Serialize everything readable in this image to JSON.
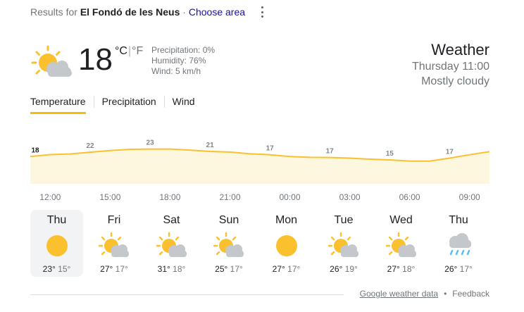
{
  "header": {
    "results_prefix": "Results for",
    "location": "El Fondó de les Neus",
    "separator": "·",
    "choose_area": "Choose area"
  },
  "current": {
    "icon": "partly-cloudy",
    "temperature": "18",
    "unit_c": "°C",
    "unit_sep": "|",
    "unit_f": "°F",
    "precipitation": "Precipitation: 0%",
    "humidity": "Humidity: 76%",
    "wind": "Wind: 5 km/h"
  },
  "title": {
    "heading": "Weather",
    "time": "Thursday 11:00",
    "condition": "Mostly cloudy"
  },
  "tabs": [
    {
      "label": "Temperature",
      "active": true
    },
    {
      "label": "Precipitation",
      "active": false
    },
    {
      "label": "Wind",
      "active": false
    }
  ],
  "chart_data": {
    "type": "area",
    "x": [
      "11:00",
      "12:00",
      "13:00",
      "14:00",
      "15:00",
      "16:00",
      "17:00",
      "18:00",
      "19:00",
      "20:00",
      "21:00",
      "22:00",
      "23:00",
      "00:00",
      "01:00",
      "02:00",
      "03:00",
      "04:00",
      "05:00",
      "06:00",
      "07:00",
      "08:00",
      "09:00",
      "10:00"
    ],
    "values": [
      18,
      19.3,
      19.7,
      20.9,
      22,
      22.8,
      23,
      23,
      22.3,
      21.4,
      21,
      19.8,
      19.2,
      18,
      17.5,
      17.4,
      17,
      16.3,
      15.8,
      15,
      15,
      17,
      19.2,
      21.2
    ],
    "labels": [
      {
        "x": "11:00",
        "text": "18"
      },
      {
        "x": "14:00",
        "text": "22"
      },
      {
        "x": "17:00",
        "text": "23"
      },
      {
        "x": "20:00",
        "text": "21"
      },
      {
        "x": "23:00",
        "text": "17"
      },
      {
        "x": "02:00",
        "text": "17"
      },
      {
        "x": "05:00",
        "text": "15"
      },
      {
        "x": "08:00",
        "text": "17"
      }
    ],
    "tick_labels": [
      "12:00",
      "15:00",
      "18:00",
      "21:00",
      "00:00",
      "03:00",
      "06:00",
      "09:00"
    ],
    "line_color": "#fbc02d",
    "fill_color": "#fef7e0"
  },
  "forecast": [
    {
      "day": "Thu",
      "icon": "sunny",
      "high": "23°",
      "low": "15°",
      "selected": true
    },
    {
      "day": "Fri",
      "icon": "partly-cloudy",
      "high": "27°",
      "low": "17°",
      "selected": false
    },
    {
      "day": "Sat",
      "icon": "partly-cloudy",
      "high": "31°",
      "low": "18°",
      "selected": false
    },
    {
      "day": "Sun",
      "icon": "partly-cloudy",
      "high": "25°",
      "low": "17°",
      "selected": false
    },
    {
      "day": "Mon",
      "icon": "sunny",
      "high": "27°",
      "low": "17°",
      "selected": false
    },
    {
      "day": "Tue",
      "icon": "partly-cloudy",
      "high": "26°",
      "low": "19°",
      "selected": false
    },
    {
      "day": "Wed",
      "icon": "partly-cloudy",
      "high": "27°",
      "low": "18°",
      "selected": false
    },
    {
      "day": "Thu",
      "icon": "rain",
      "high": "26°",
      "low": "17°",
      "selected": false
    }
  ],
  "footer": {
    "source": "Google weather data",
    "dot": "•",
    "feedback": "Feedback"
  },
  "colors": {
    "sun": "#fbc02d",
    "cloud": "#dadce0",
    "rain": "#4fc3f7",
    "link": "#1a0dab",
    "tab_underline": "#fbbc04"
  }
}
